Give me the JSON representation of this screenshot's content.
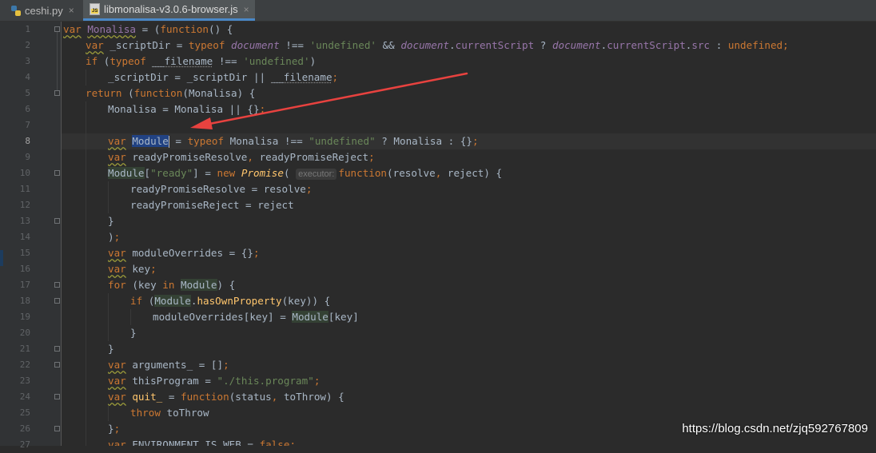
{
  "tabs": [
    {
      "label": "ceshi.py",
      "close": "×",
      "icon": "python-file-icon",
      "active": false
    },
    {
      "label": "libmonalisa-v3.0.6-browser.js",
      "close": "×",
      "icon": "js-file-icon",
      "active": true
    }
  ],
  "editor": {
    "caret_line": "8",
    "line_numbers": [
      "1",
      "2",
      "3",
      "4",
      "5",
      "6",
      "7",
      "8",
      "9",
      "10",
      "11",
      "12",
      "13",
      "14",
      "15",
      "16",
      "17",
      "18",
      "19",
      "20",
      "21",
      "22",
      "23",
      "24",
      "25",
      "26",
      "27"
    ],
    "code": {
      "l1_var": "var",
      "l1_monalisa": "Monalisa",
      "l1_a": " = (",
      "l1_fn": "function",
      "l1_b": "() {",
      "l2_var": "var",
      "l2_a": " _scriptDir = ",
      "l2_typeof": "typeof",
      "l2_document": "document",
      "l2_b": " !== ",
      "l2_undef": "'undefined'",
      "l2_c": " && ",
      "l2_document2": "document",
      "l2_d": ".",
      "l2_current": "currentScript",
      "l2_e": " ? ",
      "l2_document3": "document",
      "l2_f": ".",
      "l2_current2": "currentScript",
      "l2_g": ".",
      "l2_src": "src",
      "l2_h": " : ",
      "l2_undefined": "undefined",
      "l2_semi": ";",
      "l3_if": "if",
      "l3_a": " (",
      "l3_typeof": "typeof",
      "l3_b": " ",
      "l3_filename": "__filename",
      "l3_c": " !== ",
      "l3_undef": "'undefined'",
      "l3_d": ")",
      "l4_a": "_scriptDir = _scriptDir || ",
      "l4_filename": "__filename",
      "l4_semi": ";",
      "l5_return": "return",
      "l5_a": " (",
      "l5_fn": "function",
      "l5_b": "(",
      "l5_param": "Monalisa",
      "l5_c": ") {",
      "l6_a": "Monalisa = Monalisa || {}",
      "l6_semi": ";",
      "l8_var": "var",
      "l8_a": " ",
      "l8_module": "Module",
      "l8_b": " = ",
      "l8_typeof": "typeof",
      "l8_c": " Monalisa !== ",
      "l8_undef": "\"undefined\"",
      "l8_d": " ? Monalisa : {}",
      "l8_semi": ";",
      "l9_var": "var",
      "l9_a": " readyPromiseResolve",
      "l9_comma": ",",
      "l9_b": " readyPromiseReject",
      "l9_semi": ";",
      "l10_module": "Module",
      "l10_a": "[",
      "l10_ready": "\"ready\"",
      "l10_b": "] = ",
      "l10_new": "new",
      "l10_c": " ",
      "l10_promise": "Promise",
      "l10_d": "( ",
      "l10_hint": "executor:",
      "l10_fn": "function",
      "l10_e": "(resolve",
      "l10_comma": ",",
      "l10_f": " reject) {",
      "l11_a": "readyPromiseResolve = resolve",
      "l11_semi": ";",
      "l12_a": "readyPromiseReject = reject",
      "l13_a": "}",
      "l14_a": ")",
      "l14_semi": ";",
      "l15_var": "var",
      "l15_a": " moduleOverrides = {}",
      "l15_semi": ";",
      "l16_var": "var",
      "l16_a": " key",
      "l16_semi": ";",
      "l17_for": "for",
      "l17_a": " (key ",
      "l17_in": "in",
      "l17_b": " ",
      "l17_module": "Module",
      "l17_c": ") {",
      "l18_if": "if",
      "l18_a": " (",
      "l18_module": "Module",
      "l18_b": ".",
      "l18_has": "hasOwnProperty",
      "l18_c": "(key)) {",
      "l19_a": "moduleOverrides[key] = ",
      "l19_module": "Module",
      "l19_b": "[key]",
      "l20_a": "}",
      "l21_a": "}",
      "l22_var": "var",
      "l22_a": " arguments_ = []",
      "l22_semi": ";",
      "l23_var": "var",
      "l23_a": " thisProgram = ",
      "l23_str": "\"./this.program\"",
      "l23_semi": ";",
      "l24_var": "var",
      "l24_a": " ",
      "l24_quit": "quit_",
      "l24_b": " = ",
      "l24_fn": "function",
      "l24_c": "(status",
      "l24_comma": ",",
      "l24_d": " toThrow) {",
      "l25_throw": "throw",
      "l25_a": " toThrow",
      "l26_a": "}",
      "l26_semi": ";",
      "l27_var": "var",
      "l27_a": " ENVIRONMENT_IS_WEB = ",
      "l27_false": "false",
      "l27_semi": ";"
    }
  },
  "annotation": {
    "color": "#e8423f",
    "icon": "red-arrow"
  },
  "watermark": "https://blog.csdn.net/zjq592767809",
  "colors": {
    "keyword": "#cc7832",
    "string": "#6a8759",
    "global": "#9876aa",
    "function": "#ffc66d",
    "text": "#a9b7c6",
    "background": "#2b2b2b"
  }
}
